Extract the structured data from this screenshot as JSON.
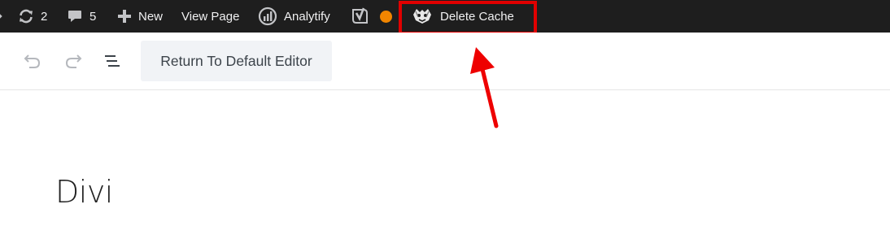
{
  "admin_bar": {
    "updates_count": "2",
    "comments_count": "5",
    "new_label": "New",
    "view_page_label": "View Page",
    "analytify_label": "Analytify",
    "delete_cache_label": "Delete Cache",
    "status_dot_color": "#f18500",
    "background_color": "#1e1e1e"
  },
  "toolbar": {
    "return_button_label": "Return To Default Editor"
  },
  "annotation": {
    "highlight_color": "#e10000"
  },
  "page": {
    "title": "Divi"
  }
}
